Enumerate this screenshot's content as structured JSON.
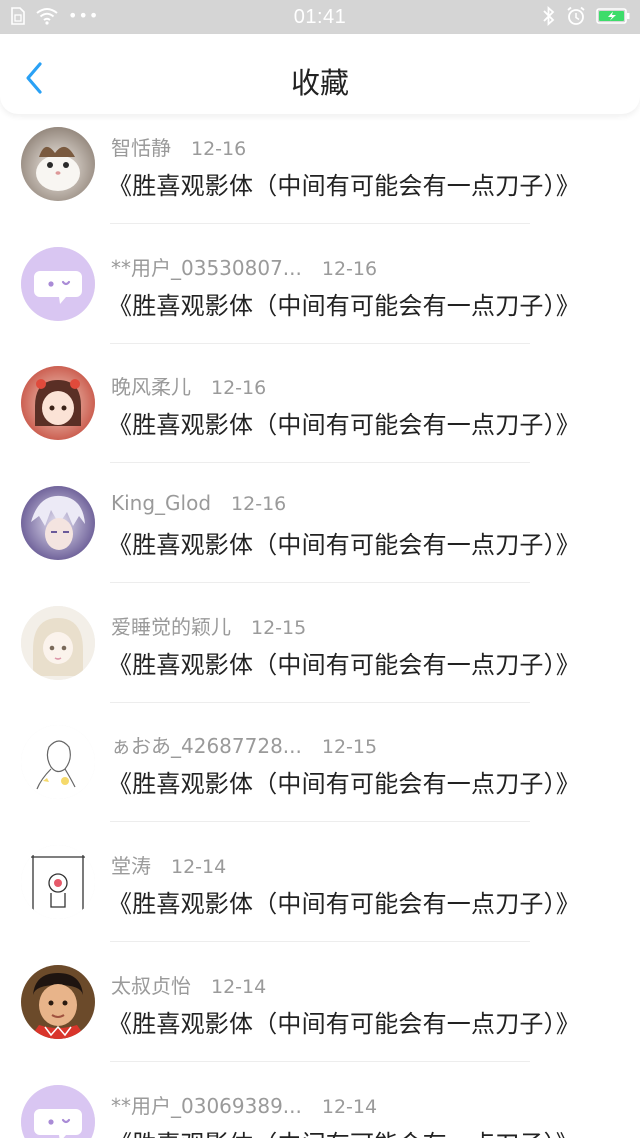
{
  "status_bar": {
    "time": "01:41",
    "icons": [
      "sim-card-icon",
      "wifi-icon",
      "more-dots-icon",
      "bluetooth-icon",
      "alarm-icon",
      "battery-charging-icon"
    ]
  },
  "nav": {
    "title": "收藏",
    "back_icon": "chevron-left-icon",
    "accent": "#2aa1f5"
  },
  "items": [
    {
      "user": "智恬静",
      "date": "12-16",
      "title": "《胜喜观影体（中间有可能会有一点刀子）》",
      "avatar": "cat-photo"
    },
    {
      "user": "**用户_03530807...",
      "date": "12-16",
      "title": "《胜喜观影体（中间有可能会有一点刀子）》",
      "avatar": "default-chat-bubble"
    },
    {
      "user": "晚风柔儿",
      "date": "12-16",
      "title": "《胜喜观影体（中间有可能会有一点刀子）》",
      "avatar": "anime-girl-red"
    },
    {
      "user": "King_Glod",
      "date": "12-16",
      "title": "《胜喜观影体（中间有可能会有一点刀子）》",
      "avatar": "anime-boy-white-hair"
    },
    {
      "user": "爱睡觉的颖儿",
      "date": "12-15",
      "title": "《胜喜观影体（中间有可能会有一点刀子）》",
      "avatar": "anime-girl-pale"
    },
    {
      "user": "ぁおあ_42687728...",
      "date": "12-15",
      "title": "《胜喜观影体（中间有可能会有一点刀子）》",
      "avatar": "sketch-girl"
    },
    {
      "user": "堂涛",
      "date": "12-14",
      "title": "《胜喜观影体（中间有可能会有一点刀子）》",
      "avatar": "doodle-frame"
    },
    {
      "user": "太叔贞怡",
      "date": "12-14",
      "title": "《胜喜观影体（中间有可能会有一点刀子）》",
      "avatar": "child-photo"
    },
    {
      "user": "**用户_03069389...",
      "date": "12-14",
      "title": "《胜喜观影体（中间有可能会有一点刀子）》",
      "avatar": "default-chat-bubble"
    }
  ]
}
